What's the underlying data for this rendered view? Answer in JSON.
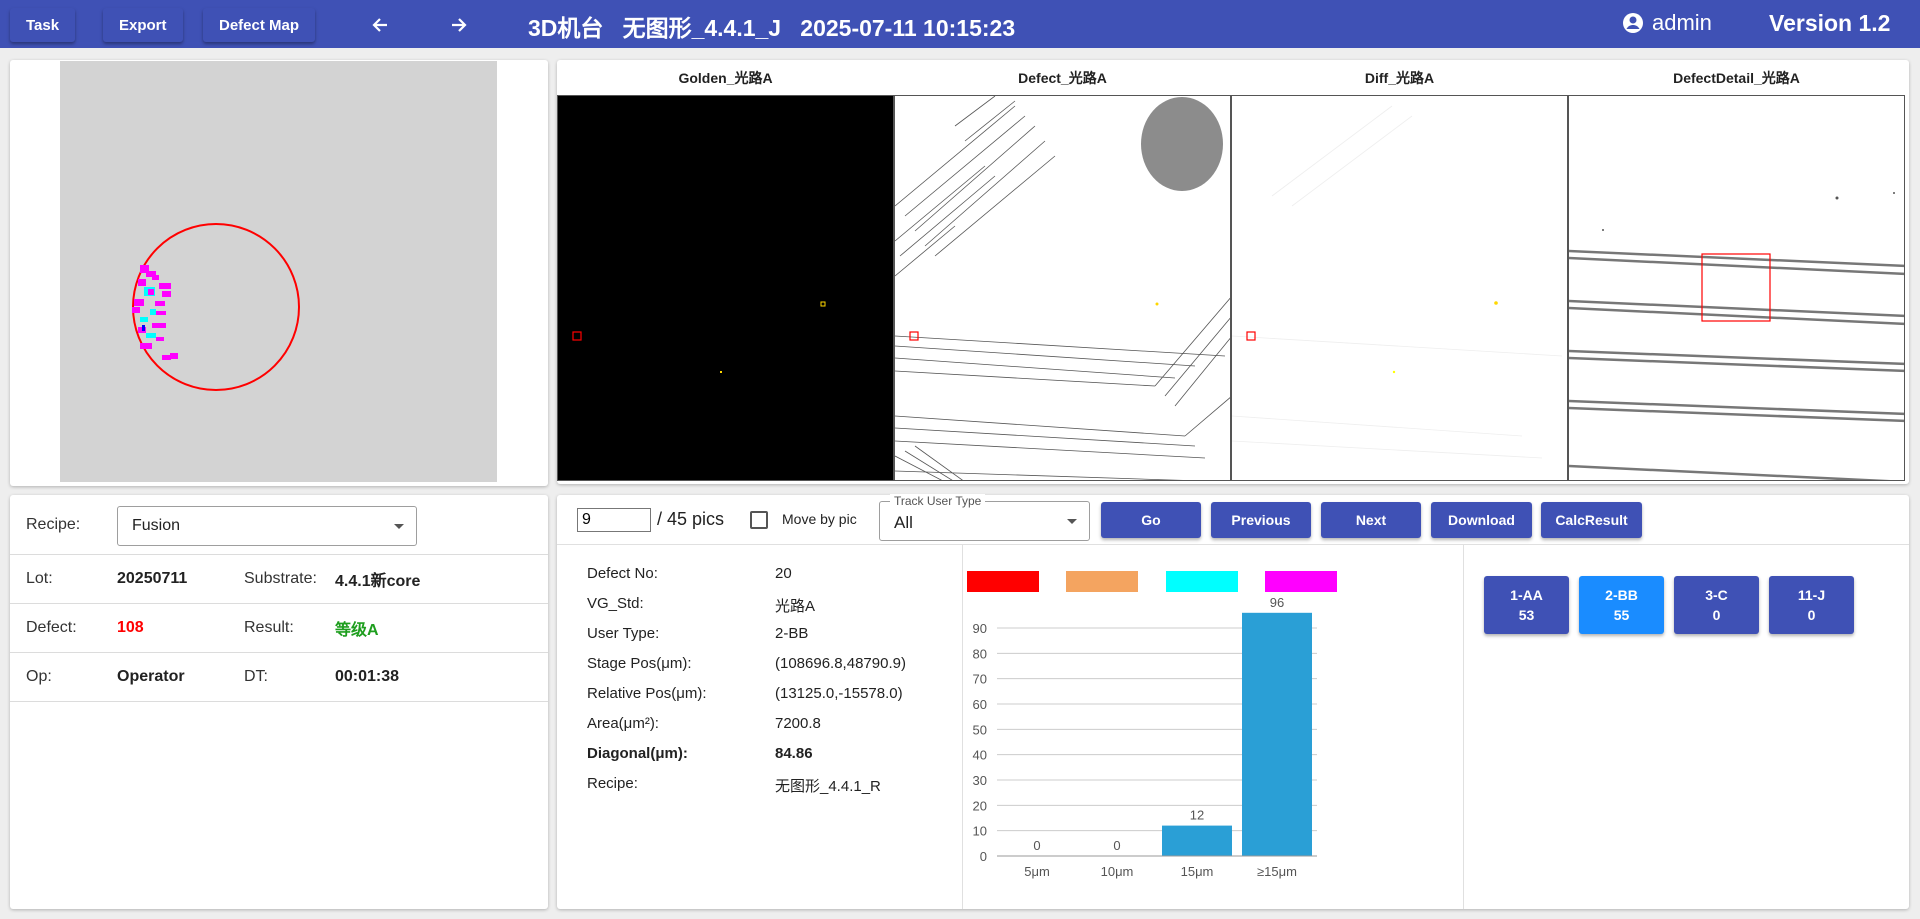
{
  "topbar": {
    "task_label": "Task",
    "export_label": "Export",
    "defect_map_label": "Defect Map",
    "title": "3D机台   无图形_4.4.1_J   2025-07-11 10:15:23",
    "user": "admin",
    "version": "Version 1.2",
    "color": "#3f51b5"
  },
  "info": {
    "recipe_label": "Recipe:",
    "recipe_value": "Fusion",
    "lot_label": "Lot:",
    "lot_value": "20250711",
    "substrate_label": "Substrate:",
    "substrate_value": "4.4.1新core",
    "defect_label": "Defect:",
    "defect_value": "108",
    "result_label": "Result:",
    "result_value": "等级A",
    "op_label": "Op:",
    "op_value": "Operator",
    "dt_label": "DT:",
    "dt_value": "00:01:38"
  },
  "images": {
    "golden_title": "Golden_光路A",
    "defect_title": "Defect_光路A",
    "diff_title": "Diff_光路A",
    "detail_title": "DefectDetail_光路A"
  },
  "controls": {
    "page_value": "9",
    "page_total": "/ 45 pics",
    "move_by_pic_label": "Move by pic",
    "track_legend": "Track User Type",
    "track_value": "All",
    "go_label": "Go",
    "previous_label": "Previous",
    "next_label": "Next",
    "download_label": "Download",
    "calcresult_label": "CalcResult"
  },
  "detail": {
    "rows": [
      {
        "label": "Defect No:",
        "value": "20"
      },
      {
        "label": "VG_Std:",
        "value": "光路A"
      },
      {
        "label": "User Type:",
        "value": "2-BB"
      },
      {
        "label": "Stage Pos(μm):",
        "value": "(108696.8,48790.9)"
      },
      {
        "label": "Relative Pos(μm):",
        "value": "(13125.0,-15578.0)"
      },
      {
        "label": "Area(μm²):",
        "value": "7200.8"
      },
      {
        "label": "Diagonal(μm):",
        "value": "84.86"
      },
      {
        "label": "Recipe:",
        "value": "无图形_4.4.1_R"
      }
    ]
  },
  "legend_colors": [
    "#ff0000",
    "#f4a460",
    "#00ffff",
    "#ff00ff"
  ],
  "chart_data": {
    "type": "bar",
    "categories": [
      "5μm",
      "10μm",
      "15μm",
      "≥15μm"
    ],
    "values": [
      0,
      0,
      12,
      96
    ],
    "ylim": [
      0,
      90
    ],
    "yticks": [
      0,
      10,
      20,
      30,
      40,
      50,
      60,
      70,
      80,
      90
    ],
    "bar_color": "#2a9fd6",
    "grid": true,
    "title": "",
    "xlabel": "",
    "ylabel": ""
  },
  "classes": [
    {
      "name": "1-AA",
      "count": "53",
      "color": "#3f51b5"
    },
    {
      "name": "2-BB",
      "count": "55",
      "color": "#1a8cff"
    },
    {
      "name": "3-C",
      "count": "0",
      "color": "#3f51b5"
    },
    {
      "name": "11-J",
      "count": "0",
      "color": "#3f51b5"
    }
  ]
}
